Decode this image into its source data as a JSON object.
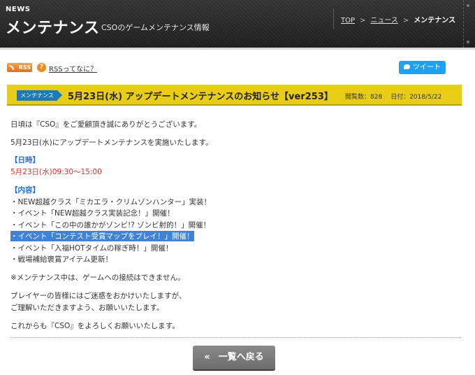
{
  "header": {
    "kicker": "NEWS",
    "title": "メンテナンス",
    "subtitle": "CSOのゲームメンテナンス情報",
    "breadcrumb": [
      {
        "label": "TOP"
      },
      {
        "label": "ニュース"
      },
      {
        "label": "メンテナンス"
      }
    ],
    "breadcrumb_separator": ">"
  },
  "toolbar": {
    "rss_badge": "RSS",
    "help_icon_glyph": "?",
    "rss_help_link": "RSSってなに？",
    "tweet_button": "ツイート"
  },
  "article": {
    "category_tag": "メンテナンス",
    "title": "5月23日(水) アップデートメンテナンスのお知らせ【ver253】",
    "views_label": "閲覧数：828",
    "date_label": "日付：2018/5/22",
    "greeting": "日頃は『CSO』をご愛顧頂き誠にありがとうございます。",
    "intro": "5月23日(水)にアップデートメンテナンスを実施いたします。",
    "schedule_heading": "【日時】",
    "schedule_value": "5月23日(水)09:30～15:00",
    "content_heading": "【内容】",
    "content_items": [
      "・NEW超越クラス「ミカエラ・クリムゾンハンター」実装！",
      "・イベント「NEW超越クラス実装記念！」開催！",
      "・イベント「この中の誰かがゾンビ!? ゾンビ射的！」開催！",
      "・イベント「コンテスト受賞マップをプレイ！」開催！",
      "・イベント「入福HOTタイムの稼ぎ時！」開催！",
      "・戦場補給褒賞アイテム更新！"
    ],
    "note": "※メンテナンス中は、ゲームへの接続はできません。",
    "apology_line1": "プレイヤーの皆様にはご迷惑をおかけいたしますが、",
    "apology_line2": "ご理解いただきますよう、お願いいたします。",
    "closing": "これからも『CSO』をよろしくお願いいたします。"
  },
  "footer": {
    "back_chevron": "«",
    "back_button": "一覧へ戻る"
  },
  "colors": {
    "header_bg": "#2e2e2e",
    "title_bar": "#e7cd16",
    "tag_blue": "#1f7ab3",
    "heading_blue": "#1f6fd0",
    "schedule_red": "#e03030",
    "selection_highlight": "#3f83d8",
    "tweet_blue": "#1da1f2",
    "rss_orange": "#e0701a"
  }
}
